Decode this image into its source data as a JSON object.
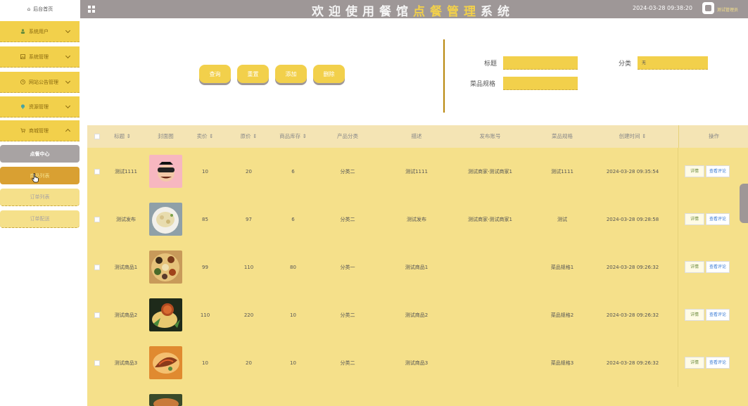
{
  "header": {
    "home_label": "后台首页",
    "title_parts": [
      "欢迎使用餐馆",
      "点餐管理",
      "系统"
    ],
    "datetime": "2024-03-28 09:38:20",
    "admin_label": "测试管理员"
  },
  "sidebar": {
    "menus": [
      {
        "label": "系统用户",
        "icon": "user-icon"
      },
      {
        "label": "系统管理",
        "icon": "image-icon"
      },
      {
        "label": "网站公告管理",
        "icon": "clock-icon"
      },
      {
        "label": "资源管理",
        "icon": "pin-icon"
      },
      {
        "label": "商城管理",
        "icon": "cart-icon"
      }
    ],
    "sub_items": [
      "点餐中心",
      "商品列表",
      "订单列表",
      "订单配送"
    ]
  },
  "toolbar": {
    "query_label": "查询",
    "reset_label": "重置",
    "add_label": "添加",
    "delete_label": "删除"
  },
  "filters": {
    "title_label": "标题",
    "category_label": "分类",
    "category_value": "无",
    "spec_label": "菜品规格"
  },
  "table": {
    "headers": [
      "标题 ⇕",
      "封面图",
      "卖价 ⇕",
      "原价 ⇕",
      "商品库存 ⇕",
      "产品分类",
      "描述",
      "发布账号",
      "菜品规格",
      "创建时间 ⇕",
      "操作"
    ],
    "rows": [
      {
        "title": "测试1111",
        "sell": "10",
        "orig": "20",
        "stock": "6",
        "cat": "分类二",
        "desc": "测试1111",
        "account": "测试商家-测试商家1",
        "spec": "测试1111",
        "time": "2024-03-28 09:35:54"
      },
      {
        "title": "测试发布",
        "sell": "85",
        "orig": "97",
        "stock": "6",
        "cat": "分类二",
        "desc": "测试发布",
        "account": "测试商家-测试商家1",
        "spec": "测试",
        "time": "2024-03-28 09:28:58"
      },
      {
        "title": "测试商品1",
        "sell": "99",
        "orig": "110",
        "stock": "80",
        "cat": "分类一",
        "desc": "测试商品1",
        "account": "",
        "spec": "菜品规格1",
        "time": "2024-03-28 09:26:32"
      },
      {
        "title": "测试商品2",
        "sell": "110",
        "orig": "220",
        "stock": "10",
        "cat": "分类二",
        "desc": "测试商品2",
        "account": "",
        "spec": "菜品规格2",
        "time": "2024-03-28 09:26:32"
      },
      {
        "title": "测试商品3",
        "sell": "10",
        "orig": "20",
        "stock": "10",
        "cat": "分类二",
        "desc": "测试商品3",
        "account": "",
        "spec": "菜品规格3",
        "time": "2024-03-28 09:26:32"
      }
    ],
    "detail_label": "详情",
    "review_label": "查看评论"
  },
  "colors": {
    "accent": "#f2d04b",
    "topbar": "#9e9797",
    "row_bg": "#f5e08a"
  }
}
